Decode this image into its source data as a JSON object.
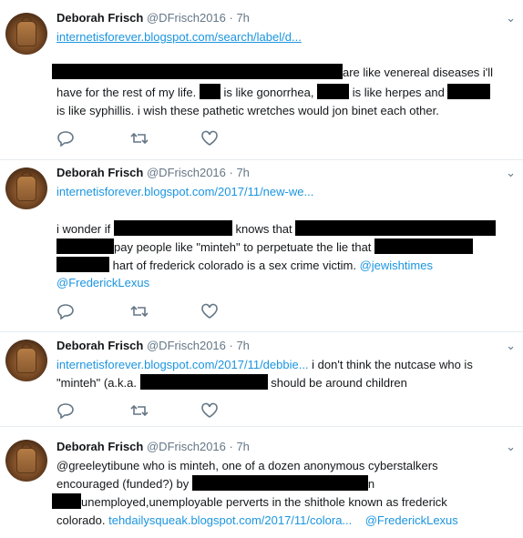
{
  "author": {
    "name": "Deborah Frisch",
    "handle": "@DFrisch2016",
    "separator": " · "
  },
  "icons": {
    "reply": "reply-icon",
    "retweet": "retweet-icon",
    "like": "heart-icon",
    "menu": "chevron-down-icon"
  },
  "tweets": [
    {
      "time": "7h",
      "link": "internetisforever.blogspot.com/search/label/d...",
      "lines": [
        {
          "t2": "are like venereal diseases i'll"
        },
        {
          "t1": "have for the rest of my life.",
          "t2": "is like gonorrhea,",
          "t3": "is like herpes and"
        },
        {
          "t1": "is like syphillis.  i wish these pathetic wretches would jon binet each other."
        }
      ]
    },
    {
      "time": "7h",
      "link": "internetisforever.blogspot.com/2017/11/new-we...",
      "lines": [
        {
          "t1": "i wonder if",
          "t2": "knows that"
        },
        {
          "t1": "pay people like \"minteh\" to perpetuate the lie that"
        },
        {
          "t1": "hart of frederick colorado is a sex crime victim.",
          "m1": "@jewishtimes"
        },
        {
          "m1": "@FrederickLexus"
        }
      ]
    },
    {
      "time": "7h",
      "link": "internetisforever.blogspot.com/2017/11/debbie...",
      "lines": [
        {
          "t1": " i don't think the nutcase who is"
        },
        {
          "t1": "\"minteh\" (a.k.a.",
          "t2": "should be around children"
        }
      ]
    },
    {
      "time": "7h",
      "lines": [
        {
          "t1": "@greeleytibune who is minteh, one of a dozen anonymous cyberstalkers"
        },
        {
          "t1": "encouraged (funded?) by",
          "t2": "n"
        },
        {
          "t1": "unemployed,unemployable perverts in the shithole known as frederick"
        },
        {
          "t1": "colorado.",
          "l1": "tehdailysqueak.blogspot.com/2017/11/colora...",
          "m1": "@FrederickLexus"
        }
      ]
    }
  ]
}
